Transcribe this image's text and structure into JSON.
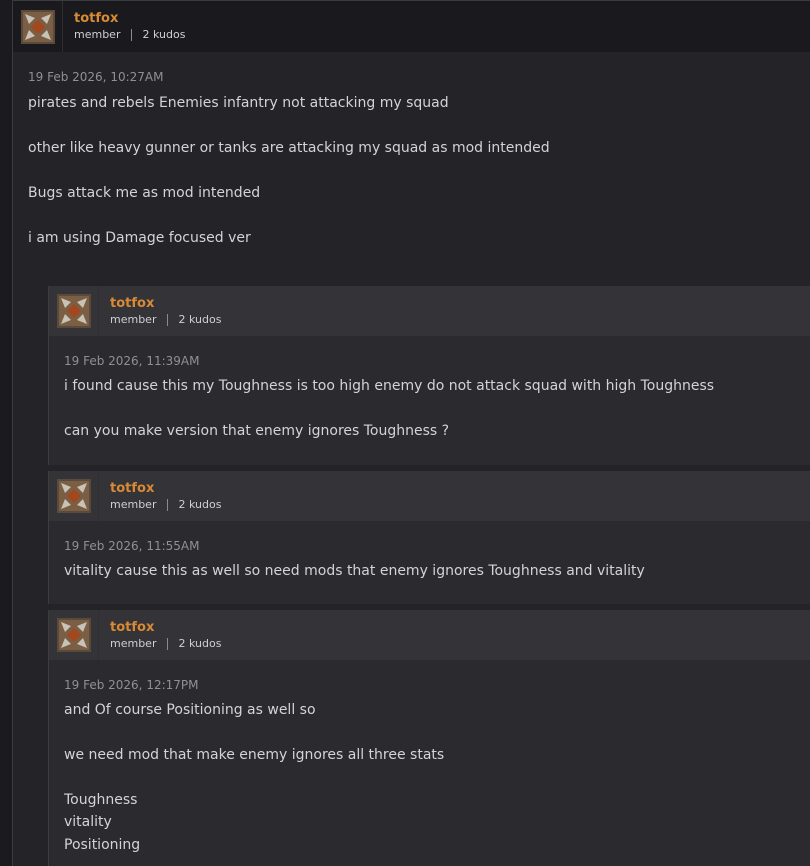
{
  "main_post": {
    "username": "totfox",
    "role": "member",
    "kudos": "2 kudos",
    "date": "19 Feb 2026, 10:27AM",
    "lines": [
      "pirates and rebels Enemies infantry not attacking my squad",
      "other like heavy gunner or tanks are attacking my squad as mod intended",
      "Bugs attack me as mod intended",
      "i am using Damage focused ver"
    ]
  },
  "replies": [
    {
      "username": "totfox",
      "role": "member",
      "kudos": "2 kudos",
      "date": "19 Feb 2026, 11:39AM",
      "lines": [
        "i found cause this my Toughness is too high enemy do not attack squad with high Toughness",
        "can you make version that enemy ignores Toughness ?"
      ]
    },
    {
      "username": "totfox",
      "role": "member",
      "kudos": "2 kudos",
      "date": "19 Feb 2026, 11:55AM",
      "lines": [
        "vitality cause this as well so need mods that enemy ignores Toughness and vitality"
      ]
    },
    {
      "username": "totfox",
      "role": "member",
      "kudos": "2 kudos",
      "date": "19 Feb 2026, 12:17PM",
      "lines": [
        "and Of course Positioning as well so",
        "we need mod that make enemy ignores all three stats",
        "Toughness",
        "vitality",
        "Positioning"
      ]
    }
  ],
  "icons": {
    "avatar": "avatar-icon"
  },
  "colors": {
    "username": "#d98a35",
    "background": "#232328"
  }
}
